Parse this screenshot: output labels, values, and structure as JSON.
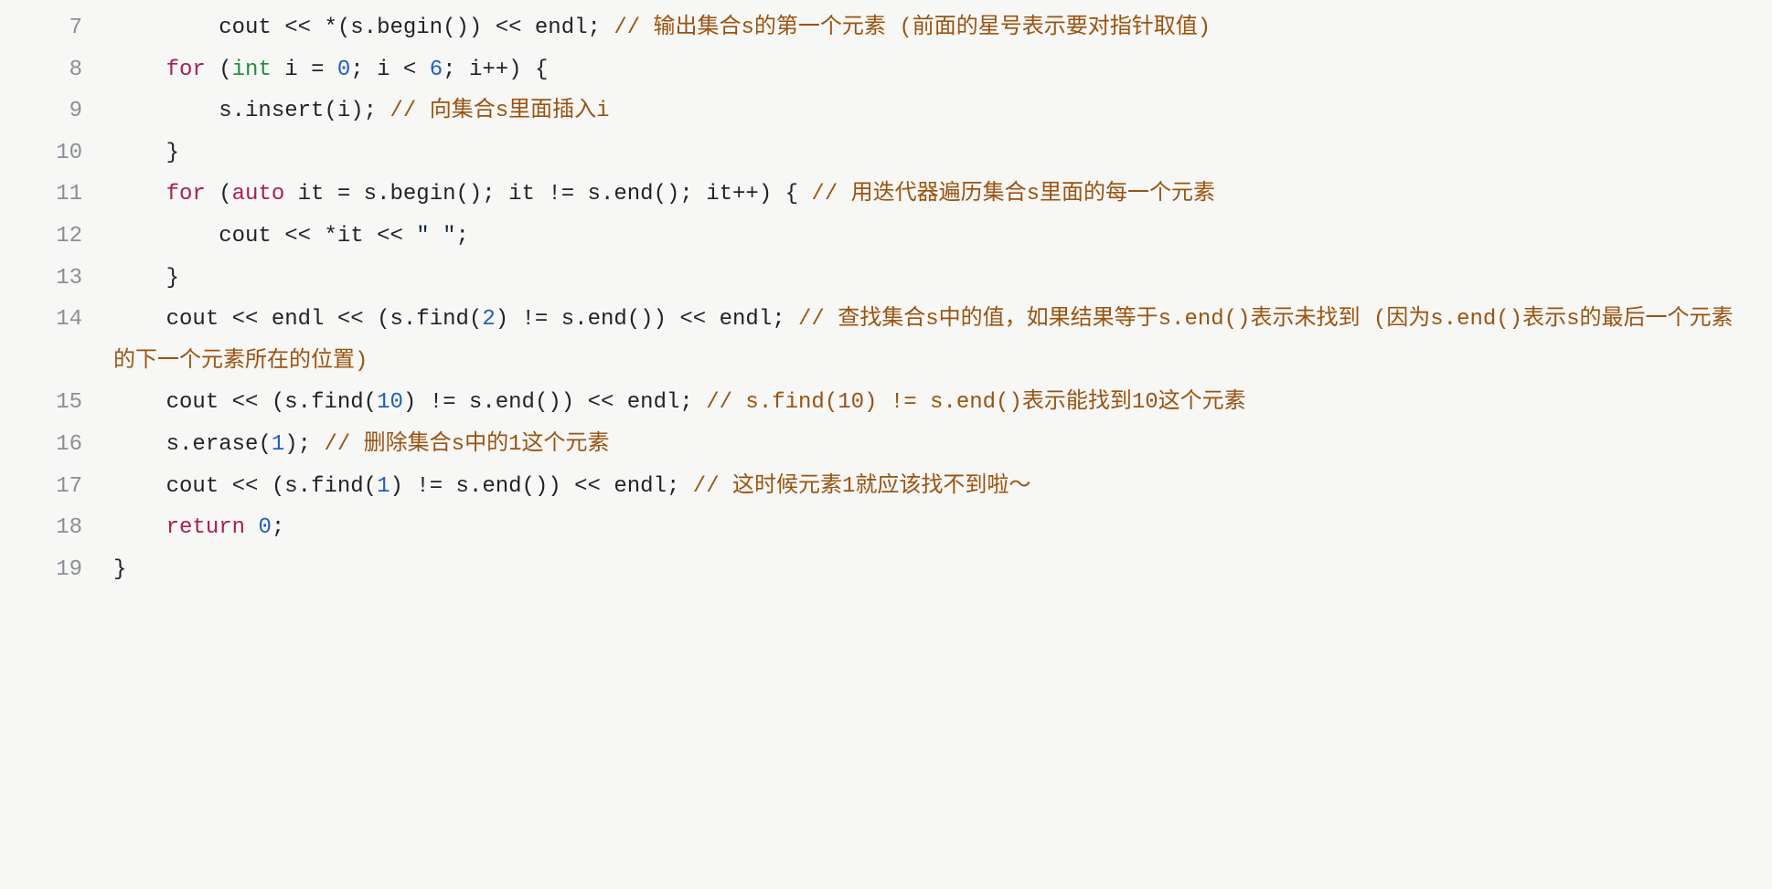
{
  "code": {
    "lines": [
      {
        "num": "7",
        "indent": "        ",
        "tokens": [
          {
            "cls": "tok-id",
            "t": "cout "
          },
          {
            "cls": "tok-op",
            "t": "<< *"
          },
          {
            "cls": "tok-punct",
            "t": "("
          },
          {
            "cls": "tok-id",
            "t": "s"
          },
          {
            "cls": "tok-punct",
            "t": "."
          },
          {
            "cls": "tok-id",
            "t": "begin"
          },
          {
            "cls": "tok-punct",
            "t": "()) "
          },
          {
            "cls": "tok-op",
            "t": "<< "
          },
          {
            "cls": "tok-id",
            "t": "endl"
          },
          {
            "cls": "tok-punct",
            "t": "; "
          },
          {
            "cls": "tok-cmt",
            "t": "// 输出集合s的第一个元素 (前面的星号表示要对指针取值)"
          }
        ]
      },
      {
        "num": "8",
        "indent": "    ",
        "tokens": [
          {
            "cls": "tok-kw",
            "t": "for"
          },
          {
            "cls": "tok-punct",
            "t": " ("
          },
          {
            "cls": "tok-type",
            "t": "int"
          },
          {
            "cls": "tok-id",
            "t": " i "
          },
          {
            "cls": "tok-op",
            "t": "= "
          },
          {
            "cls": "tok-num",
            "t": "0"
          },
          {
            "cls": "tok-punct",
            "t": "; "
          },
          {
            "cls": "tok-id",
            "t": "i "
          },
          {
            "cls": "tok-op",
            "t": "< "
          },
          {
            "cls": "tok-num",
            "t": "6"
          },
          {
            "cls": "tok-punct",
            "t": "; "
          },
          {
            "cls": "tok-id",
            "t": "i"
          },
          {
            "cls": "tok-op",
            "t": "++"
          },
          {
            "cls": "tok-punct",
            "t": ") {"
          }
        ]
      },
      {
        "num": "9",
        "indent": "        ",
        "tokens": [
          {
            "cls": "tok-id",
            "t": "s"
          },
          {
            "cls": "tok-punct",
            "t": "."
          },
          {
            "cls": "tok-id",
            "t": "insert"
          },
          {
            "cls": "tok-punct",
            "t": "("
          },
          {
            "cls": "tok-id",
            "t": "i"
          },
          {
            "cls": "tok-punct",
            "t": "); "
          },
          {
            "cls": "tok-cmt",
            "t": "// 向集合s里面插入i"
          }
        ]
      },
      {
        "num": "10",
        "indent": "    ",
        "tokens": [
          {
            "cls": "tok-punct",
            "t": "}"
          }
        ]
      },
      {
        "num": "11",
        "indent": "    ",
        "tokens": [
          {
            "cls": "tok-kw",
            "t": "for"
          },
          {
            "cls": "tok-punct",
            "t": " ("
          },
          {
            "cls": "tok-kw",
            "t": "auto"
          },
          {
            "cls": "tok-id",
            "t": " it "
          },
          {
            "cls": "tok-op",
            "t": "= "
          },
          {
            "cls": "tok-id",
            "t": "s"
          },
          {
            "cls": "tok-punct",
            "t": "."
          },
          {
            "cls": "tok-id",
            "t": "begin"
          },
          {
            "cls": "tok-punct",
            "t": "(); "
          },
          {
            "cls": "tok-id",
            "t": "it "
          },
          {
            "cls": "tok-op",
            "t": "!= "
          },
          {
            "cls": "tok-id",
            "t": "s"
          },
          {
            "cls": "tok-punct",
            "t": "."
          },
          {
            "cls": "tok-id",
            "t": "end"
          },
          {
            "cls": "tok-punct",
            "t": "(); "
          },
          {
            "cls": "tok-id",
            "t": "it"
          },
          {
            "cls": "tok-op",
            "t": "++"
          },
          {
            "cls": "tok-punct",
            "t": ") { "
          },
          {
            "cls": "tok-cmt",
            "t": "// 用迭代器遍历集合s里面的每一个元素"
          }
        ]
      },
      {
        "num": "12",
        "indent": "        ",
        "tokens": [
          {
            "cls": "tok-id",
            "t": "cout "
          },
          {
            "cls": "tok-op",
            "t": "<< *"
          },
          {
            "cls": "tok-id",
            "t": "it "
          },
          {
            "cls": "tok-op",
            "t": "<< "
          },
          {
            "cls": "tok-str",
            "t": "\" \""
          },
          {
            "cls": "tok-punct",
            "t": ";"
          }
        ]
      },
      {
        "num": "13",
        "indent": "    ",
        "tokens": [
          {
            "cls": "tok-punct",
            "t": "}"
          }
        ]
      },
      {
        "num": "14",
        "indent": "    ",
        "tokens": [
          {
            "cls": "tok-id",
            "t": "cout "
          },
          {
            "cls": "tok-op",
            "t": "<< "
          },
          {
            "cls": "tok-id",
            "t": "endl "
          },
          {
            "cls": "tok-op",
            "t": "<< "
          },
          {
            "cls": "tok-punct",
            "t": "("
          },
          {
            "cls": "tok-id",
            "t": "s"
          },
          {
            "cls": "tok-punct",
            "t": "."
          },
          {
            "cls": "tok-id",
            "t": "find"
          },
          {
            "cls": "tok-punct",
            "t": "("
          },
          {
            "cls": "tok-num",
            "t": "2"
          },
          {
            "cls": "tok-punct",
            "t": ") "
          },
          {
            "cls": "tok-op",
            "t": "!= "
          },
          {
            "cls": "tok-id",
            "t": "s"
          },
          {
            "cls": "tok-punct",
            "t": "."
          },
          {
            "cls": "tok-id",
            "t": "end"
          },
          {
            "cls": "tok-punct",
            "t": "()) "
          },
          {
            "cls": "tok-op",
            "t": "<< "
          },
          {
            "cls": "tok-id",
            "t": "endl"
          },
          {
            "cls": "tok-punct",
            "t": "; "
          },
          {
            "cls": "tok-cmt",
            "t": "// 查找集合s中的值，如果结果等于s.end()表示未找到 (因为s.end()表示s的最后一个元素的下一个元素所在的位置)"
          }
        ]
      },
      {
        "num": "15",
        "indent": "    ",
        "tokens": [
          {
            "cls": "tok-id",
            "t": "cout "
          },
          {
            "cls": "tok-op",
            "t": "<< "
          },
          {
            "cls": "tok-punct",
            "t": "("
          },
          {
            "cls": "tok-id",
            "t": "s"
          },
          {
            "cls": "tok-punct",
            "t": "."
          },
          {
            "cls": "tok-id",
            "t": "find"
          },
          {
            "cls": "tok-punct",
            "t": "("
          },
          {
            "cls": "tok-num",
            "t": "10"
          },
          {
            "cls": "tok-punct",
            "t": ") "
          },
          {
            "cls": "tok-op",
            "t": "!= "
          },
          {
            "cls": "tok-id",
            "t": "s"
          },
          {
            "cls": "tok-punct",
            "t": "."
          },
          {
            "cls": "tok-id",
            "t": "end"
          },
          {
            "cls": "tok-punct",
            "t": "()) "
          },
          {
            "cls": "tok-op",
            "t": "<< "
          },
          {
            "cls": "tok-id",
            "t": "endl"
          },
          {
            "cls": "tok-punct",
            "t": "; "
          },
          {
            "cls": "tok-cmt",
            "t": "// s.find(10) != s.end()表示能找到10这个元素"
          }
        ]
      },
      {
        "num": "16",
        "indent": "    ",
        "tokens": [
          {
            "cls": "tok-id",
            "t": "s"
          },
          {
            "cls": "tok-punct",
            "t": "."
          },
          {
            "cls": "tok-id",
            "t": "erase"
          },
          {
            "cls": "tok-punct",
            "t": "("
          },
          {
            "cls": "tok-num",
            "t": "1"
          },
          {
            "cls": "tok-punct",
            "t": "); "
          },
          {
            "cls": "tok-cmt",
            "t": "// 删除集合s中的1这个元素"
          }
        ]
      },
      {
        "num": "17",
        "indent": "    ",
        "tokens": [
          {
            "cls": "tok-id",
            "t": "cout "
          },
          {
            "cls": "tok-op",
            "t": "<< "
          },
          {
            "cls": "tok-punct",
            "t": "("
          },
          {
            "cls": "tok-id",
            "t": "s"
          },
          {
            "cls": "tok-punct",
            "t": "."
          },
          {
            "cls": "tok-id",
            "t": "find"
          },
          {
            "cls": "tok-punct",
            "t": "("
          },
          {
            "cls": "tok-num",
            "t": "1"
          },
          {
            "cls": "tok-punct",
            "t": ") "
          },
          {
            "cls": "tok-op",
            "t": "!= "
          },
          {
            "cls": "tok-id",
            "t": "s"
          },
          {
            "cls": "tok-punct",
            "t": "."
          },
          {
            "cls": "tok-id",
            "t": "end"
          },
          {
            "cls": "tok-punct",
            "t": "()) "
          },
          {
            "cls": "tok-op",
            "t": "<< "
          },
          {
            "cls": "tok-id",
            "t": "endl"
          },
          {
            "cls": "tok-punct",
            "t": "; "
          },
          {
            "cls": "tok-cmt",
            "t": "// 这时候元素1就应该找不到啦～"
          }
        ]
      },
      {
        "num": "18",
        "indent": "    ",
        "tokens": [
          {
            "cls": "tok-kw",
            "t": "return"
          },
          {
            "cls": "tok-punct",
            "t": " "
          },
          {
            "cls": "tok-num",
            "t": "0"
          },
          {
            "cls": "tok-punct",
            "t": ";"
          }
        ]
      },
      {
        "num": "19",
        "indent": "",
        "tokens": [
          {
            "cls": "tok-punct",
            "t": "}"
          }
        ]
      }
    ]
  }
}
